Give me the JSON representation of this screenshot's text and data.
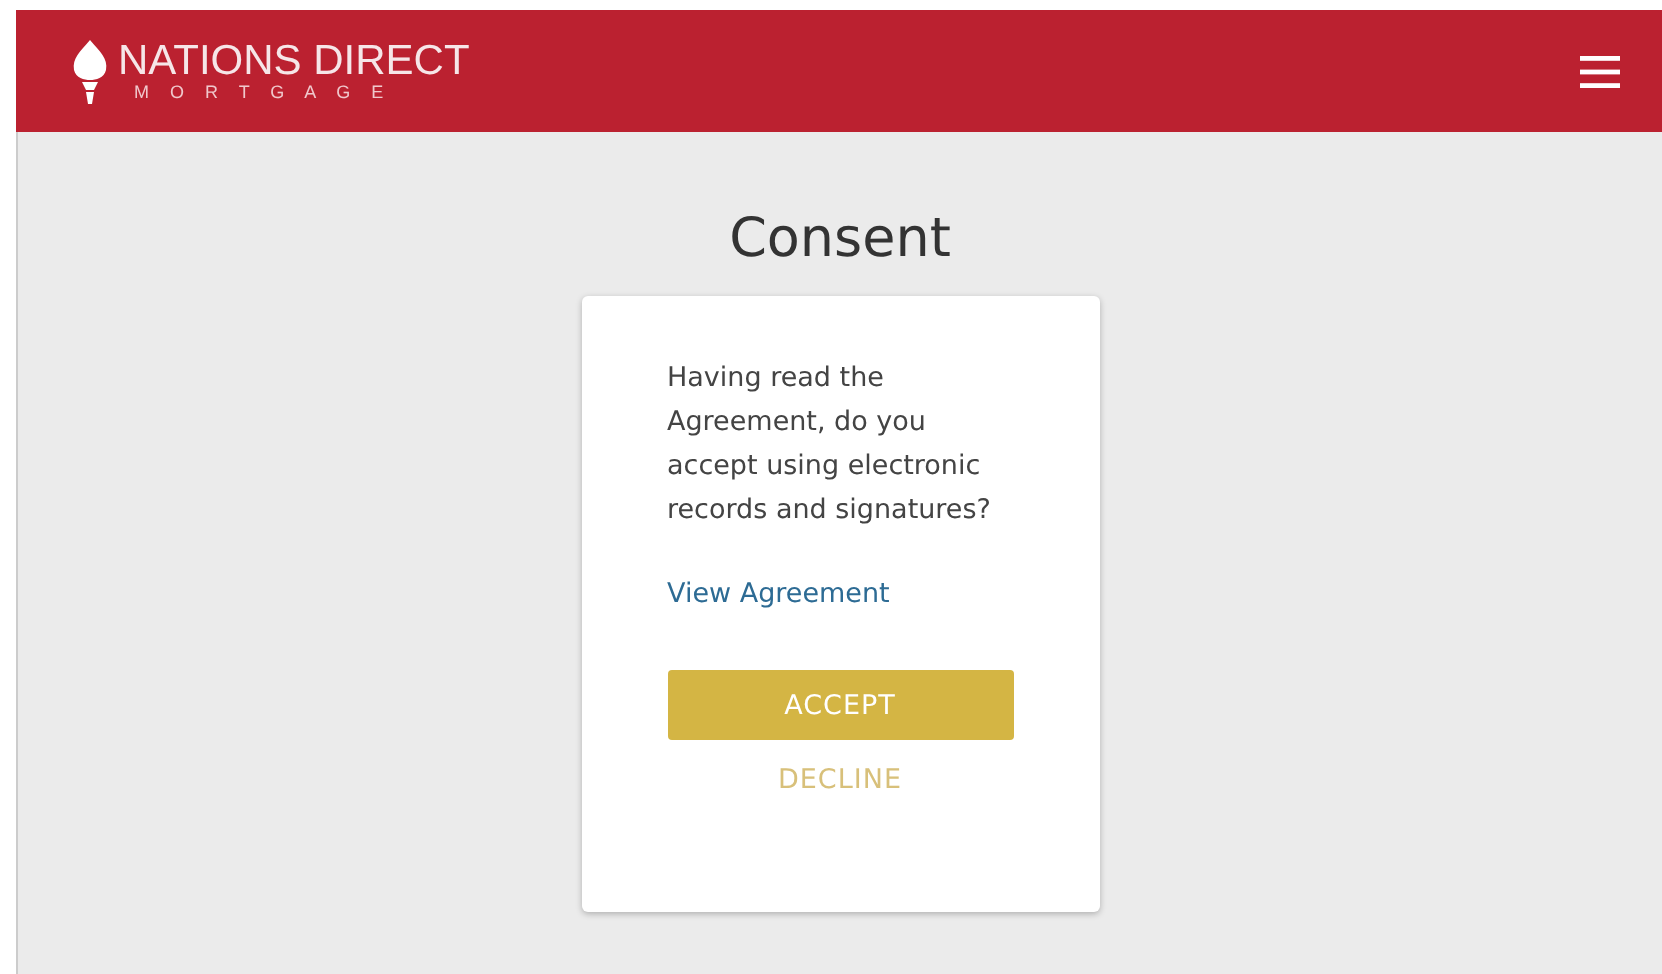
{
  "header": {
    "logo": {
      "name": "NATIONS DIRECT",
      "tagline": "M O R T G A G E"
    }
  },
  "page": {
    "title": "Consent"
  },
  "card": {
    "question": "Having read the Agreement, do you accept using electronic records and signatures?",
    "link": "View Agreement",
    "buttons": [
      {
        "label": "ACCEPT",
        "kind": "primary"
      },
      {
        "label": "DECLINE",
        "kind": "text"
      }
    ]
  }
}
